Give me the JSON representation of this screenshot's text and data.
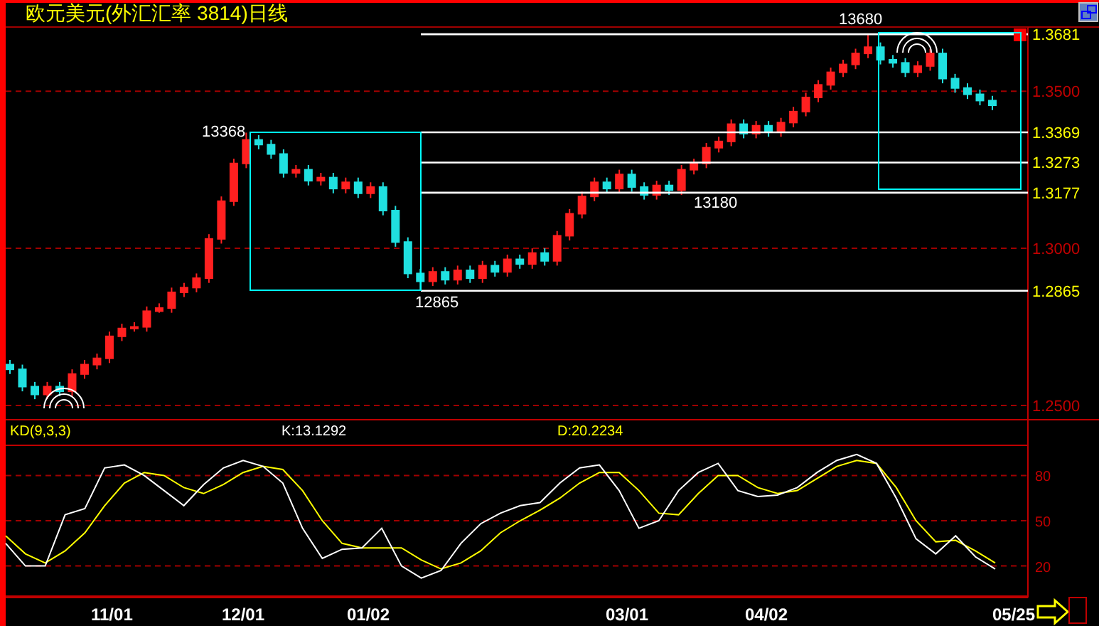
{
  "title": "欧元美元(外汇汇率 3814)日线",
  "price_chart": {
    "tick_highlighted": [
      true,
      false,
      true,
      true,
      true,
      false,
      true,
      false
    ],
    "point_labels": [
      {
        "text": "13368"
      },
      {
        "text": "12865"
      },
      {
        "text": "13180"
      },
      {
        "text": "13680"
      }
    ],
    "chart_data": {
      "type": "candlestick",
      "ylim": [
        1.25,
        1.3704
      ],
      "grid": true,
      "yticks": [
        {
          "value": 1.3681,
          "label": "1.3681"
        },
        {
          "value": 1.35,
          "label": "1.3500"
        },
        {
          "value": 1.3369,
          "label": "1.3369"
        },
        {
          "value": 1.3273,
          "label": "1.3273"
        },
        {
          "value": 1.3177,
          "label": "1.3177"
        },
        {
          "value": 1.3,
          "label": "1.3000"
        },
        {
          "value": 1.2865,
          "label": "1.2865"
        },
        {
          "value": 1.25,
          "label": "1.2500"
        }
      ],
      "categories": [
        null,
        null,
        null,
        null,
        null,
        null,
        null,
        null,
        null,
        null,
        null,
        null,
        null,
        null,
        null,
        null,
        null,
        null,
        null,
        null,
        null,
        null,
        null,
        null,
        null,
        null,
        null,
        null,
        null,
        null,
        null,
        null,
        null,
        null,
        null,
        null,
        null,
        null,
        null,
        null,
        null,
        null,
        null,
        null,
        null,
        null,
        null,
        null,
        null,
        null,
        null,
        null,
        null,
        null,
        null,
        null,
        null,
        null,
        null,
        null,
        null,
        null,
        null,
        null,
        null,
        null,
        null,
        null,
        null,
        null,
        null,
        null,
        null,
        null,
        null,
        null,
        null,
        null,
        null,
        null
      ],
      "ohlc": [
        [
          1.263,
          1.2645,
          1.26,
          1.2615
        ],
        [
          1.2615,
          1.263,
          1.2545,
          1.256
        ],
        [
          1.256,
          1.2575,
          1.252,
          1.2535
        ],
        [
          1.2535,
          1.2575,
          1.252,
          1.256
        ],
        [
          1.256,
          1.2575,
          1.253,
          1.2545
        ],
        [
          1.2545,
          1.2615,
          1.253,
          1.26
        ],
        [
          1.26,
          1.2645,
          1.2585,
          1.263
        ],
        [
          1.263,
          1.2665,
          1.2615,
          1.265
        ],
        [
          1.265,
          1.2735,
          1.2635,
          1.272
        ],
        [
          1.272,
          1.276,
          1.2705,
          1.2745
        ],
        [
          1.2745,
          1.2765,
          1.2735,
          1.275
        ],
        [
          1.275,
          1.2815,
          1.2735,
          1.28
        ],
        [
          1.28,
          1.2825,
          1.2795,
          1.281
        ],
        [
          1.281,
          1.2875,
          1.2795,
          1.286
        ],
        [
          1.286,
          1.289,
          1.2845,
          1.2875
        ],
        [
          1.2875,
          1.292,
          1.286,
          1.2905
        ],
        [
          1.2905,
          1.3045,
          1.289,
          1.303
        ],
        [
          1.303,
          1.3165,
          1.3015,
          1.315
        ],
        [
          1.315,
          1.3285,
          1.3135,
          1.327
        ],
        [
          1.327,
          1.3368,
          1.3255,
          1.3345
        ],
        [
          1.3345,
          1.336,
          1.3315,
          1.333
        ],
        [
          1.333,
          1.3345,
          1.3285,
          1.33
        ],
        [
          1.33,
          1.3315,
          1.3225,
          1.324
        ],
        [
          1.324,
          1.3265,
          1.3225,
          1.325
        ],
        [
          1.325,
          1.3265,
          1.32,
          1.3215
        ],
        [
          1.3215,
          1.324,
          1.32,
          1.3225
        ],
        [
          1.3225,
          1.324,
          1.3175,
          1.319
        ],
        [
          1.319,
          1.3225,
          1.3175,
          1.321
        ],
        [
          1.321,
          1.3225,
          1.316,
          1.3175
        ],
        [
          1.3175,
          1.321,
          1.316,
          1.3195
        ],
        [
          1.3195,
          1.321,
          1.3105,
          1.312
        ],
        [
          1.312,
          1.3135,
          1.3005,
          1.302
        ],
        [
          1.302,
          1.3035,
          1.2905,
          1.292
        ],
        [
          1.292,
          1.2935,
          1.2865,
          1.2895
        ],
        [
          1.2895,
          1.294,
          1.288,
          1.2925
        ],
        [
          1.2925,
          1.294,
          1.2885,
          1.29
        ],
        [
          1.29,
          1.2945,
          1.2885,
          1.293
        ],
        [
          1.293,
          1.2945,
          1.289,
          1.2905
        ],
        [
          1.2905,
          1.296,
          1.289,
          1.2945
        ],
        [
          1.2945,
          1.296,
          1.291,
          1.2925
        ],
        [
          1.2925,
          1.298,
          1.291,
          1.2965
        ],
        [
          1.2965,
          1.298,
          1.2935,
          1.295
        ],
        [
          1.295,
          1.3,
          1.2935,
          1.2985
        ],
        [
          1.2985,
          1.3,
          1.2945,
          1.296
        ],
        [
          1.296,
          1.3055,
          1.2945,
          1.304
        ],
        [
          1.304,
          1.3125,
          1.3025,
          1.311
        ],
        [
          1.311,
          1.318,
          1.3095,
          1.3165
        ],
        [
          1.3165,
          1.3225,
          1.315,
          1.321
        ],
        [
          1.321,
          1.3225,
          1.3175,
          1.319
        ],
        [
          1.319,
          1.325,
          1.3175,
          1.3235
        ],
        [
          1.3235,
          1.325,
          1.318,
          1.3195
        ],
        [
          1.3195,
          1.321,
          1.3155,
          1.317
        ],
        [
          1.317,
          1.3215,
          1.3155,
          1.32
        ],
        [
          1.32,
          1.3215,
          1.317,
          1.3185
        ],
        [
          1.3185,
          1.3265,
          1.317,
          1.325
        ],
        [
          1.325,
          1.3285,
          1.3235,
          1.327
        ],
        [
          1.327,
          1.3335,
          1.3255,
          1.332
        ],
        [
          1.332,
          1.3355,
          1.3305,
          1.334
        ],
        [
          1.334,
          1.341,
          1.3325,
          1.3395
        ],
        [
          1.3395,
          1.341,
          1.335,
          1.3365
        ],
        [
          1.3365,
          1.3405,
          1.335,
          1.339
        ],
        [
          1.339,
          1.3405,
          1.3355,
          1.337
        ],
        [
          1.337,
          1.3415,
          1.3355,
          1.34
        ],
        [
          1.34,
          1.345,
          1.3385,
          1.3435
        ],
        [
          1.3435,
          1.3495,
          1.342,
          1.348
        ],
        [
          1.348,
          1.3535,
          1.3465,
          1.352
        ],
        [
          1.352,
          1.3575,
          1.3505,
          1.356
        ],
        [
          1.356,
          1.36,
          1.3545,
          1.3585
        ],
        [
          1.3585,
          1.3635,
          1.357,
          1.362
        ],
        [
          1.362,
          1.368,
          1.3605,
          1.364
        ],
        [
          1.364,
          1.3655,
          1.3585,
          1.36
        ],
        [
          1.36,
          1.3615,
          1.3575,
          1.359
        ],
        [
          1.359,
          1.3605,
          1.3545,
          1.356
        ],
        [
          1.356,
          1.3595,
          1.3545,
          1.358
        ],
        [
          1.358,
          1.3635,
          1.3565,
          1.362
        ],
        [
          1.362,
          1.3635,
          1.3525,
          1.354
        ],
        [
          1.354,
          1.3555,
          1.3495,
          1.351
        ],
        [
          1.351,
          1.3525,
          1.3475,
          1.349
        ],
        [
          1.349,
          1.3505,
          1.3455,
          1.347
        ],
        [
          1.347,
          1.3485,
          1.344,
          1.3455
        ]
      ]
    }
  },
  "indicator": {
    "name": "KD(9,3,3)",
    "k": "K:13.1292",
    "d": "D:20.2234",
    "chart_data": {
      "type": "line",
      "ylim": [
        0,
        100
      ],
      "grid": true,
      "yticks": [
        20,
        50,
        80
      ],
      "series": [
        {
          "color": "#ffffff",
          "values": [
            35,
            20,
            20,
            54,
            58,
            85,
            87,
            80,
            70,
            60,
            74,
            85,
            90,
            86,
            75,
            45,
            25,
            31,
            32,
            45,
            20,
            12,
            17,
            35,
            48,
            55,
            60,
            62,
            75,
            85,
            87,
            70,
            45,
            50,
            70,
            82,
            88,
            70,
            66,
            67,
            72,
            82,
            90,
            94,
            88,
            65,
            38,
            28,
            40,
            26,
            18
          ]
        },
        {
          "color": "#ffff00",
          "values": [
            40,
            28,
            22,
            30,
            42,
            60,
            75,
            82,
            80,
            72,
            68,
            74,
            82,
            86,
            84,
            70,
            50,
            35,
            32,
            32,
            32,
            24,
            18,
            22,
            30,
            42,
            50,
            57,
            65,
            75,
            82,
            82,
            70,
            55,
            54,
            68,
            80,
            80,
            72,
            68,
            70,
            78,
            86,
            90,
            88,
            72,
            50,
            36,
            37,
            30,
            22
          ]
        }
      ]
    }
  },
  "dates": [
    "11/01",
    "12/01",
    "01/02",
    "03/01",
    "04/02",
    "05/25"
  ]
}
